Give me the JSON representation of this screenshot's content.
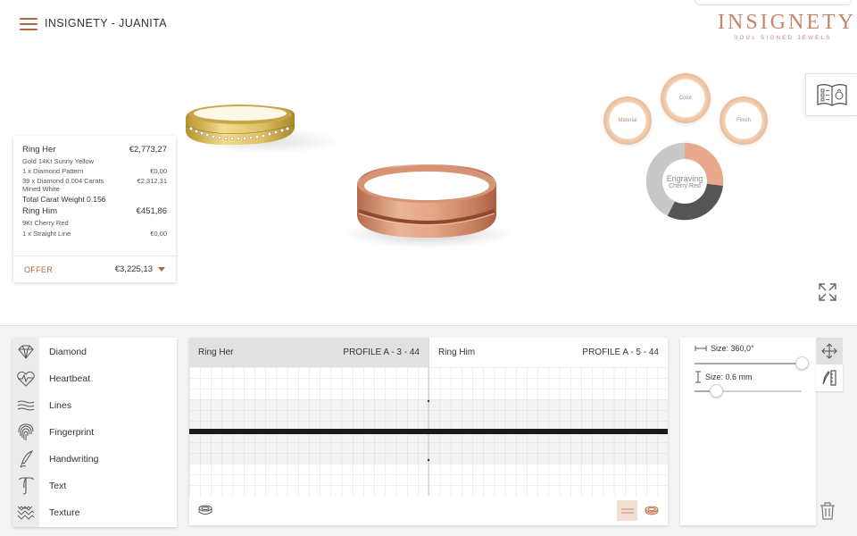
{
  "header": {
    "title": "INSIGNETY - JUANITA",
    "logo_main": "INSIGNETY",
    "logo_sub": "SOUL SIGNED JEWELS"
  },
  "price_card": {
    "ring_her_label": "Ring Her",
    "ring_her_price": "€2,773,27",
    "ring_her_material": "Gold 14Kt Sunny Yellow",
    "diamond_pattern_label": "1 x Diamond Pattern",
    "diamond_pattern_price": "€0,00",
    "diamonds_label": "39 x Diamond 0.004 Carats",
    "diamonds_price": "€2,312,31",
    "diamonds_color": "Mined White",
    "carat_weight": "Total Carat Weight 0.156",
    "ring_him_label": "Ring Him",
    "ring_him_price": "€451,86",
    "ring_him_material": "9Kt Cherry Red",
    "straight_line_label": "1 x Straight Line",
    "straight_line_price": "€0,00",
    "offer_label": "OFFER",
    "offer_total": "€3,225,13"
  },
  "bubbles": {
    "material": "Material",
    "color": "Color",
    "finish": "Finish",
    "engraving_title": "Engraving",
    "engraving_sub": "Cherry Red"
  },
  "patterns": [
    {
      "label": "Diamond",
      "icon": "diamond-icon"
    },
    {
      "label": "Heartbeat",
      "icon": "heartbeat-icon"
    },
    {
      "label": "Lines",
      "icon": "lines-icon"
    },
    {
      "label": "Fingerprint",
      "icon": "fingerprint-icon"
    },
    {
      "label": "Handwriting",
      "icon": "handwriting-icon"
    },
    {
      "label": "Text",
      "icon": "text-icon"
    },
    {
      "label": "Texture",
      "icon": "texture-icon"
    }
  ],
  "editor": {
    "tabs": [
      {
        "label": "Ring Her",
        "profile": "PROFILE A - 3 - 44"
      },
      {
        "label": "Ring Him",
        "profile": "PROFILE A - 5 - 44"
      }
    ]
  },
  "size_panel": {
    "angle_label": "Size: 360,0°",
    "angle_value": 360,
    "angle_max": 360,
    "width_label": "Size: 0.6 mm",
    "width_fraction": 0.2
  },
  "colors": {
    "accent": "#b4633f",
    "rose_gold": "#e3a184",
    "logo": "#c8846a"
  }
}
